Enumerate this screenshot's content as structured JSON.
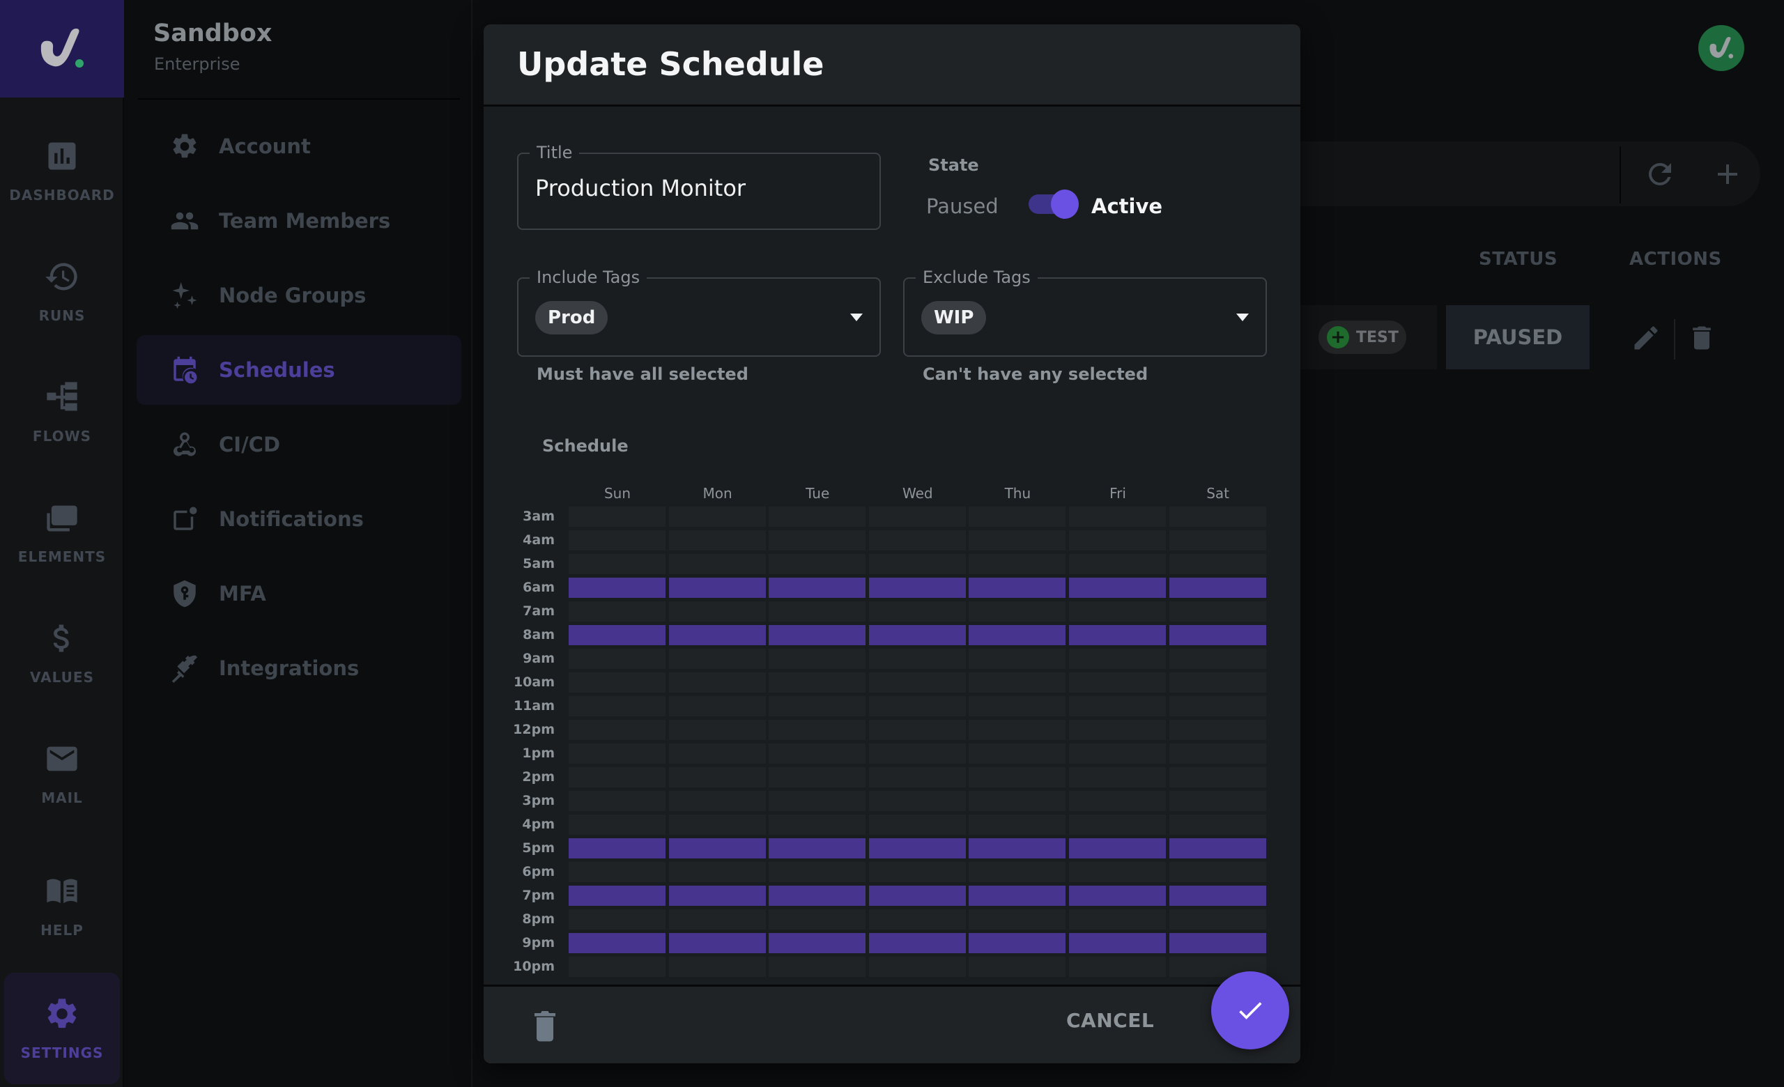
{
  "rail": {
    "items": [
      {
        "key": "dashboard",
        "label": "DASHBOARD",
        "icon": "bar-chart-icon",
        "active": false
      },
      {
        "key": "runs",
        "label": "RUNS",
        "icon": "history-icon",
        "active": false
      },
      {
        "key": "flows",
        "label": "FLOWS",
        "icon": "flow-tree-icon",
        "active": false
      },
      {
        "key": "elements",
        "label": "ELEMENTS",
        "icon": "layers-icon",
        "active": false
      },
      {
        "key": "values",
        "label": "VALUES",
        "icon": "dollar-icon",
        "active": false
      },
      {
        "key": "mail",
        "label": "MAIL",
        "icon": "mail-icon",
        "active": false
      },
      {
        "key": "help",
        "label": "HELP",
        "icon": "book-icon",
        "active": false
      },
      {
        "key": "settings",
        "label": "SETTINGS",
        "icon": "gear-icon",
        "active": true
      }
    ]
  },
  "panel": {
    "org_name": "Sandbox",
    "org_plan": "Enterprise",
    "items": [
      {
        "key": "account",
        "label": "Account",
        "icon": "gear-icon",
        "active": false
      },
      {
        "key": "team-members",
        "label": "Team Members",
        "icon": "users-icon",
        "active": false
      },
      {
        "key": "node-groups",
        "label": "Node Groups",
        "icon": "sparkles-icon",
        "active": false
      },
      {
        "key": "schedules",
        "label": "Schedules",
        "icon": "calendar-clock-icon",
        "active": true
      },
      {
        "key": "ci-cd",
        "label": "CI/CD",
        "icon": "webhook-icon",
        "active": false
      },
      {
        "key": "notifications",
        "label": "Notifications",
        "icon": "notification-icon",
        "active": false
      },
      {
        "key": "mfa",
        "label": "MFA",
        "icon": "shield-key-icon",
        "active": false
      },
      {
        "key": "integrations",
        "label": "Integrations",
        "icon": "plug-icon",
        "active": false
      }
    ]
  },
  "background": {
    "columns": {
      "status": "STATUS",
      "actions": "ACTIONS"
    },
    "row": {
      "tag": "TEST",
      "status": "PAUSED"
    }
  },
  "dialog": {
    "title": "Update Schedule",
    "title_field": {
      "label": "Title",
      "value": "Production Monitor"
    },
    "state": {
      "label": "State",
      "off_label": "Paused",
      "on_label": "Active",
      "active": true
    },
    "include_tags": {
      "label": "Include Tags",
      "selected": [
        "Prod"
      ],
      "helper": "Must have all selected"
    },
    "exclude_tags": {
      "label": "Exclude Tags",
      "selected": [
        "WIP"
      ],
      "helper": "Can't have any selected"
    },
    "schedule": {
      "label": "Schedule",
      "days": [
        "Sun",
        "Mon",
        "Tue",
        "Wed",
        "Thu",
        "Fri",
        "Sat"
      ],
      "hours": [
        "3am",
        "4am",
        "5am",
        "6am",
        "7am",
        "8am",
        "9am",
        "10am",
        "11am",
        "12pm",
        "1pm",
        "2pm",
        "3pm",
        "4pm",
        "5pm",
        "6pm",
        "7pm",
        "8pm",
        "9pm",
        "10pm"
      ],
      "selected_hours_all_days": [
        "6am",
        "8am",
        "5pm",
        "7pm",
        "9pm"
      ]
    },
    "cancel_label": "CANCEL"
  },
  "colors": {
    "accent": "#6a50e3",
    "selected_cell": "#47348f",
    "empty_cell": "#202326",
    "logo_bg": "#221a52",
    "status_green": "#1f6a2d"
  }
}
